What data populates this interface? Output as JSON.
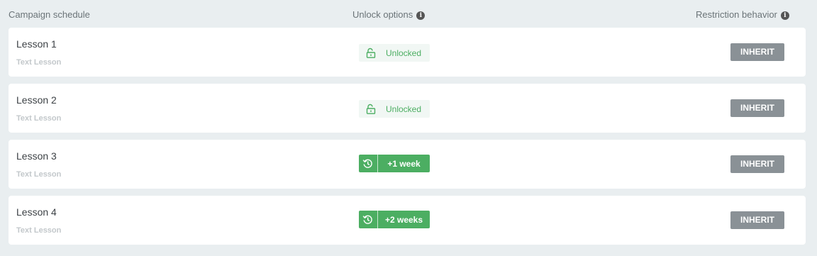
{
  "header": {
    "schedule_label": "Campaign schedule",
    "unlock_label": "Unlock options",
    "restriction_label": "Restriction behavior",
    "info_glyph": "i"
  },
  "colors": {
    "accent_green": "#4cae62",
    "inherit_gray": "#8a9196",
    "page_bg": "#e9eef0"
  },
  "lessons": [
    {
      "title": "Lesson 1",
      "type": "Text Lesson",
      "unlock": {
        "kind": "unlocked",
        "label": "Unlocked",
        "icon": "lock-open-icon"
      },
      "restriction": "INHERIT"
    },
    {
      "title": "Lesson 2",
      "type": "Text Lesson",
      "unlock": {
        "kind": "unlocked",
        "label": "Unlocked",
        "icon": "lock-open-icon"
      },
      "restriction": "INHERIT"
    },
    {
      "title": "Lesson 3",
      "type": "Text Lesson",
      "unlock": {
        "kind": "delay",
        "label": "+1 week",
        "icon": "history-icon"
      },
      "restriction": "INHERIT"
    },
    {
      "title": "Lesson 4",
      "type": "Text Lesson",
      "unlock": {
        "kind": "delay",
        "label": "+2 weeks",
        "icon": "history-icon"
      },
      "restriction": "INHERIT"
    }
  ]
}
